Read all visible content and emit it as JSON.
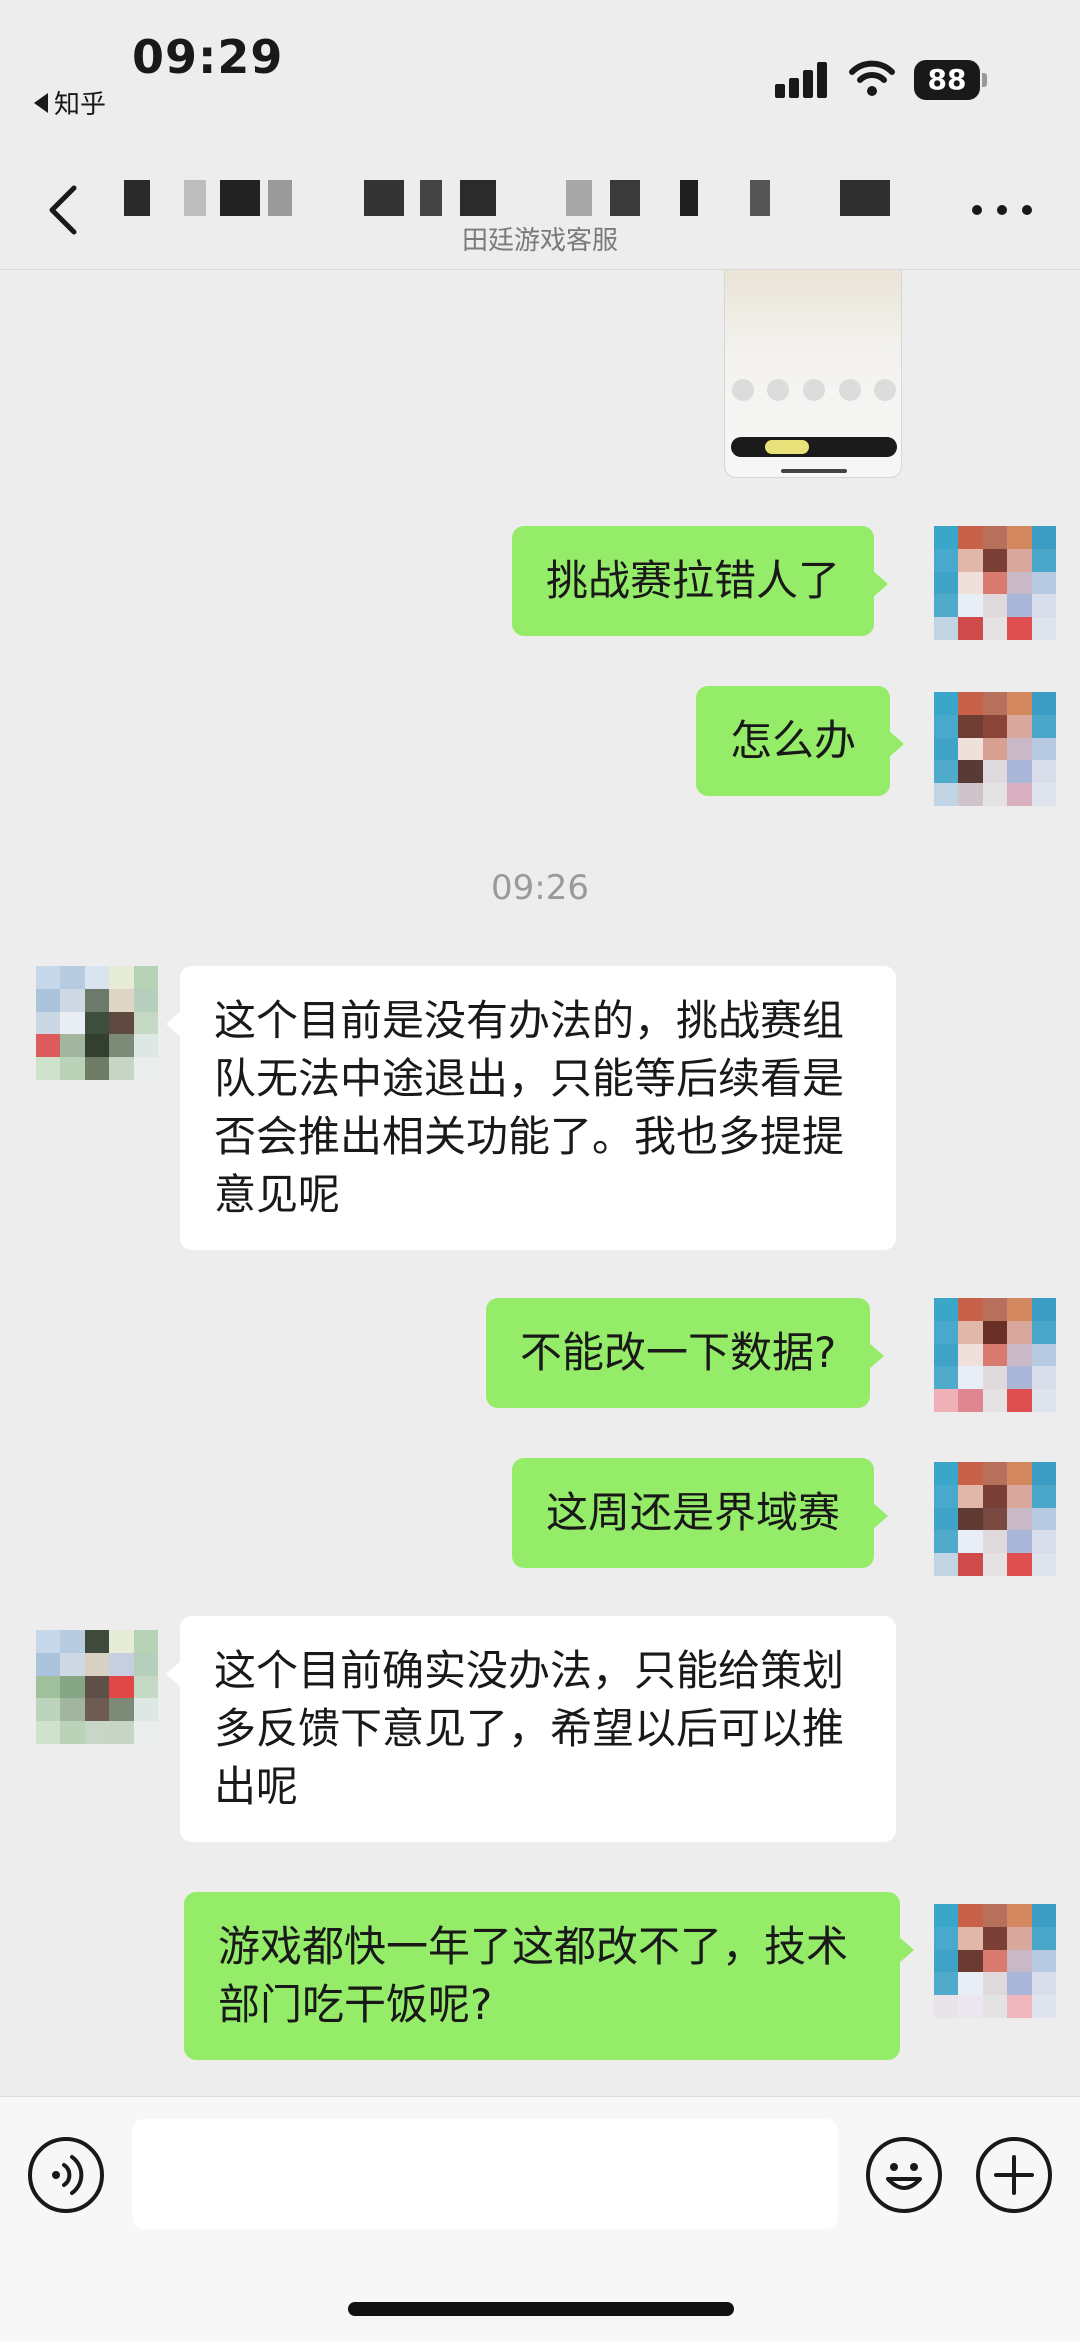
{
  "status_bar": {
    "time": "09:29",
    "back_app": "知乎",
    "battery": "88"
  },
  "header": {
    "subtitle": "田廷游戏客服"
  },
  "messages": [
    {
      "side": "out",
      "text": "挑战赛拉错人了"
    },
    {
      "side": "out",
      "text": "怎么办"
    },
    {
      "side": "time",
      "text": "09:26"
    },
    {
      "side": "in",
      "text": "这个目前是没有办法的，挑战赛组队无法中途退出，只能等后续看是否会推出相关功能了。我也多提提意见呢"
    },
    {
      "side": "out",
      "text": "不能改一下数据?"
    },
    {
      "side": "out",
      "text": "这周还是界域赛"
    },
    {
      "side": "in",
      "text": "这个目前确实没办法，只能给策划多反馈下意见了，希望以后可以推出呢"
    },
    {
      "side": "out",
      "text": "游戏都快一年了这都改不了，技术部门吃干饭呢?"
    }
  ],
  "input": {
    "placeholder": ""
  },
  "icons": {
    "back": "chevron-left-icon",
    "more": "more-dots-icon",
    "voice": "voice-icon",
    "emoji": "emoji-icon",
    "plus": "plus-icon"
  },
  "colors": {
    "outgoing_bubble": "#95ec69",
    "incoming_bubble": "#ffffff",
    "background": "#ededed"
  }
}
